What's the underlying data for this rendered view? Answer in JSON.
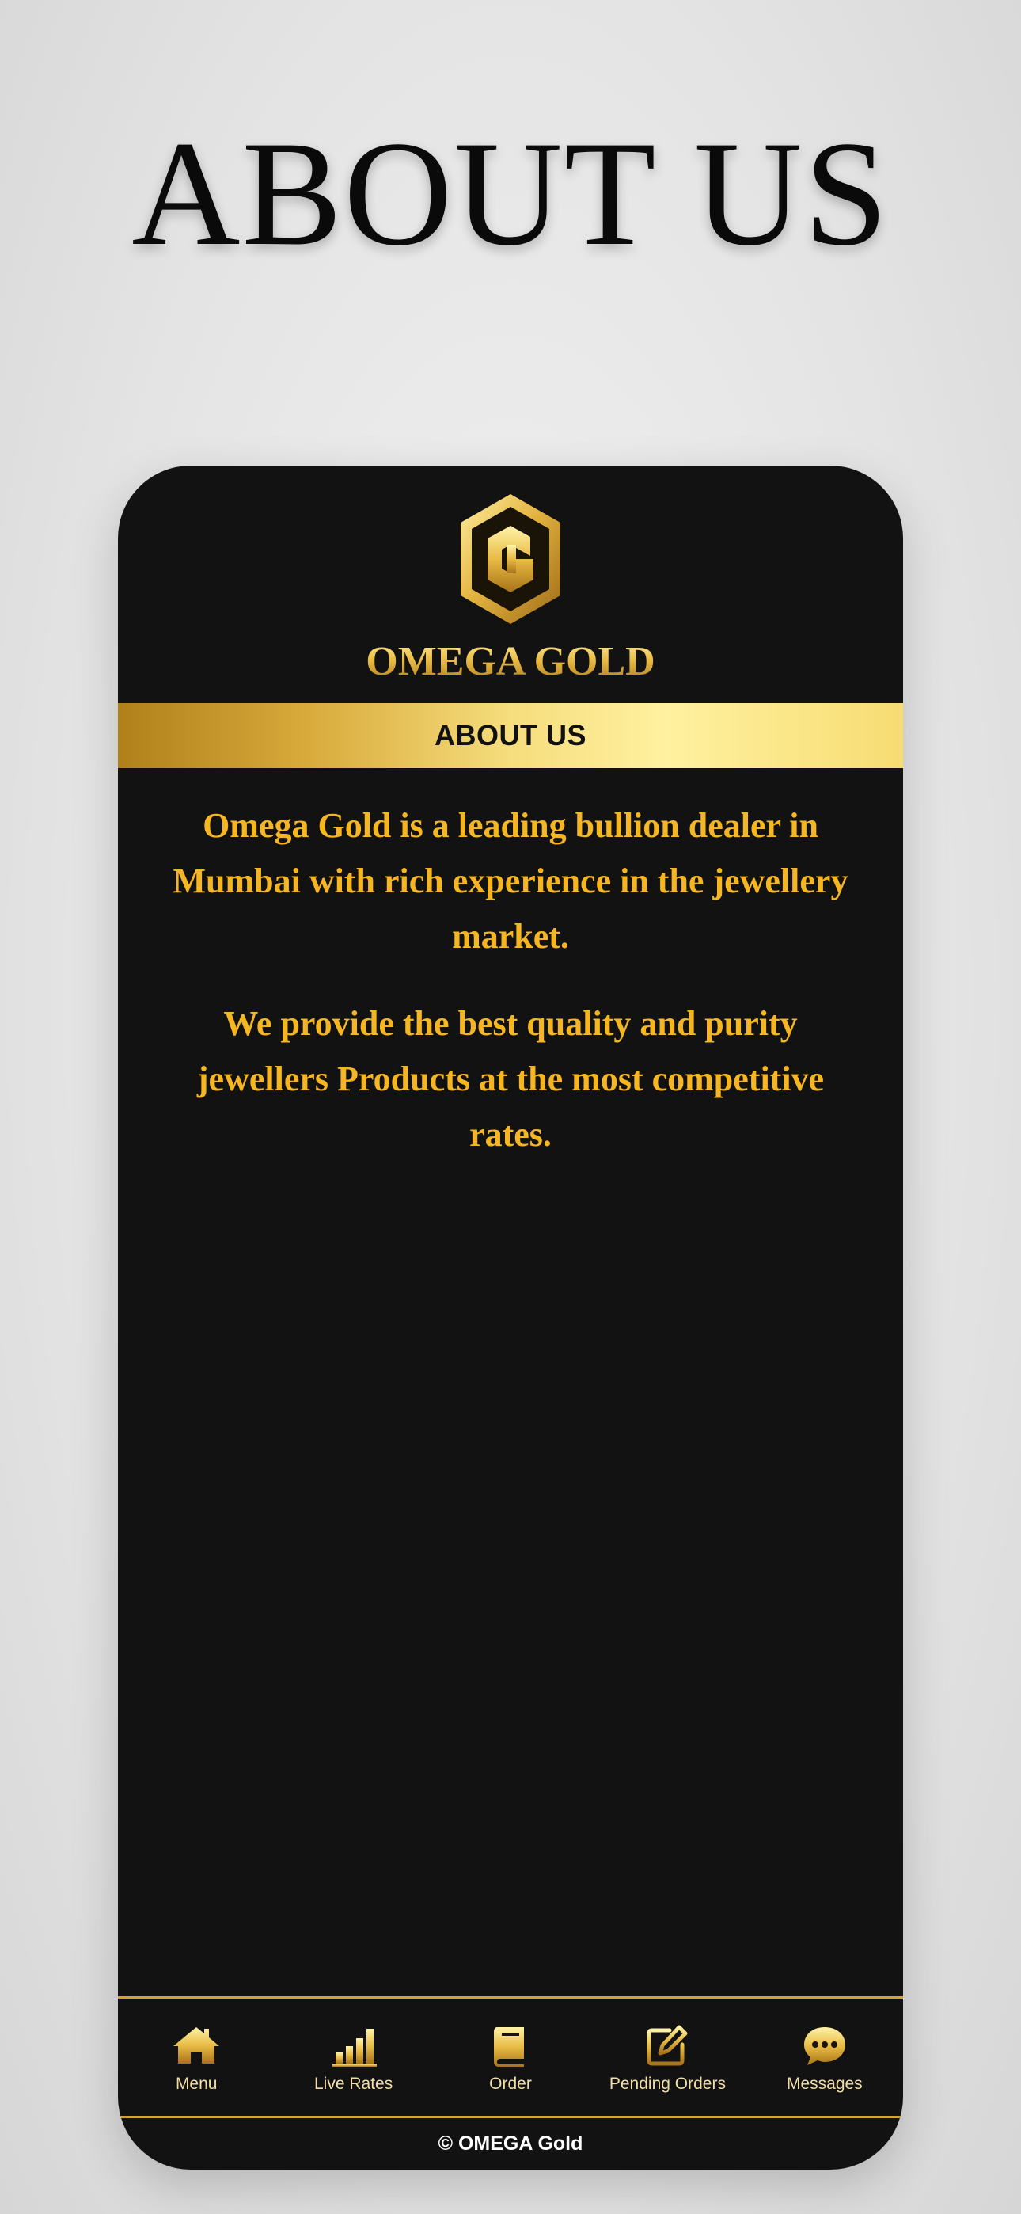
{
  "page": {
    "title": "ABOUT US"
  },
  "app": {
    "brand_name": "OMEGA GOLD",
    "logo_icon": "omega-gold-hexagon-logo",
    "section_title": "ABOUT US",
    "paragraphs": [
      "Omega Gold is a leading bullion dealer in Mumbai with rich experience in the jewellery market.",
      "We provide the best quality and purity jewellers Products at the most competitive rates."
    ],
    "nav": [
      {
        "label": "Menu",
        "icon": "home-icon"
      },
      {
        "label": "Live Rates",
        "icon": "bar-chart-icon"
      },
      {
        "label": "Order",
        "icon": "book-icon"
      },
      {
        "label": "Pending Orders",
        "icon": "edit-icon"
      },
      {
        "label": "Messages",
        "icon": "chat-bubble-icon"
      }
    ],
    "footer": "© OMEGA Gold"
  },
  "colors": {
    "background": "#e6e6e6",
    "phone_background": "#121212",
    "gold_text": "#f5b621",
    "gold_accent": "#d4a237",
    "nav_label": "#f3dfa4"
  }
}
